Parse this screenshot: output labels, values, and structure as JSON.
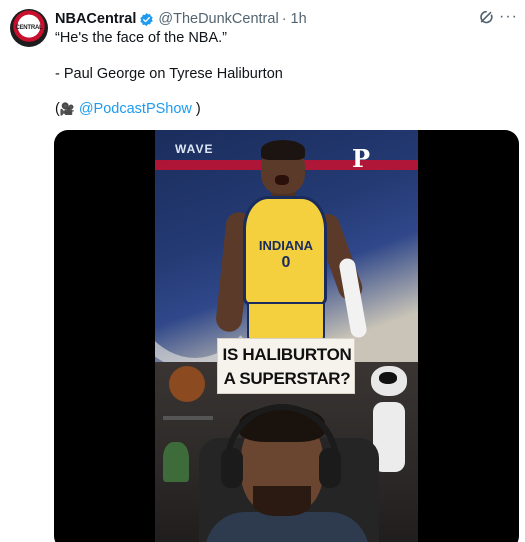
{
  "tweet": {
    "author_name": "NBACentral",
    "handle": "@TheDunkCentral",
    "separator": "·",
    "time": "1h",
    "avatar_text": "CENTRAL",
    "line1": "“He's the face of the NBA.”",
    "line2": "- Paul George on Tyrese Haliburton",
    "line3_open": "(",
    "line3_camera": "🎥",
    "line3_mention": "@PodcastPShow",
    "line3_close": ")"
  },
  "video": {
    "wave_text": "WAVE",
    "logo_text": "P",
    "jersey_team": "INDIANA",
    "jersey_number": "0",
    "title_line1": "IS HALIBURTON",
    "title_line2": "A SUPERSTAR?"
  },
  "icons": {
    "verified": "verified-badge-icon",
    "grok": "grok-icon",
    "more": "more-icon"
  },
  "colors": {
    "link": "#1d9bf0",
    "secondary_text": "#536471",
    "primary_text": "#0f1419"
  }
}
